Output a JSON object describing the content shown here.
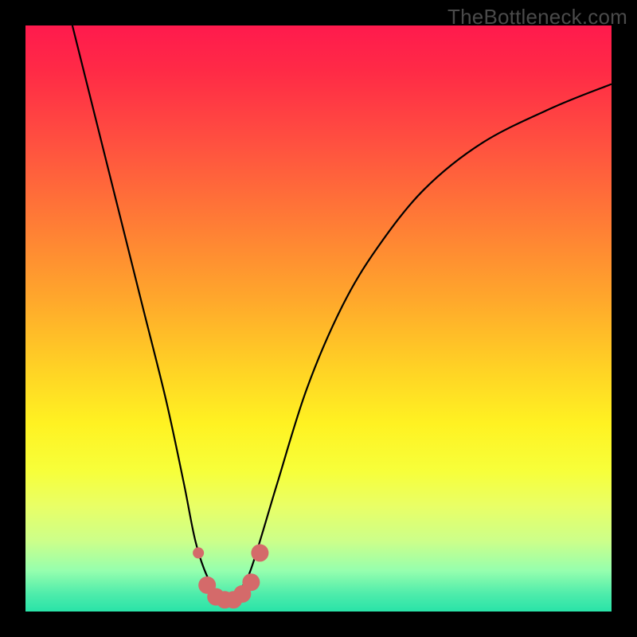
{
  "watermark": "TheBottleneck.com",
  "chart_data": {
    "type": "line",
    "title": "",
    "xlabel": "",
    "ylabel": "",
    "xlim": [
      0,
      100
    ],
    "ylim": [
      0,
      100
    ],
    "series": [
      {
        "name": "bottleneck-curve",
        "x": [
          8,
          12,
          16,
          20,
          24,
          27,
          29,
          31,
          33,
          34.5,
          36,
          38,
          40,
          43,
          48,
          54,
          60,
          68,
          78,
          90,
          100
        ],
        "y": [
          100,
          84,
          68,
          52,
          36,
          22,
          12,
          6,
          3,
          2,
          3,
          6,
          12,
          22,
          38,
          52,
          62,
          72,
          80,
          86,
          90
        ]
      }
    ],
    "markers": {
      "name": "highlight-band",
      "color": "#d46a6a",
      "points": [
        {
          "x": 29.5,
          "y": 10
        },
        {
          "x": 31,
          "y": 4.5
        },
        {
          "x": 32.5,
          "y": 2.5
        },
        {
          "x": 34,
          "y": 2
        },
        {
          "x": 35.5,
          "y": 2
        },
        {
          "x": 37,
          "y": 3
        },
        {
          "x": 38.5,
          "y": 5
        },
        {
          "x": 40,
          "y": 10
        }
      ]
    },
    "background_gradient": {
      "top_color": "#ff1a4d",
      "mid_color": "#fff222",
      "bottom_color": "#29e3a8"
    }
  }
}
